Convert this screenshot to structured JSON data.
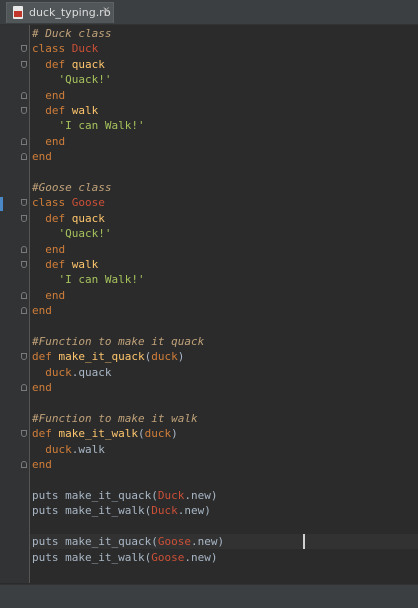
{
  "tab": {
    "filename": "duck_typing.rb",
    "file_icon": "ruby-file-icon",
    "close_glyph": "×"
  },
  "colors": {
    "editor_bg": "#2b2b2b",
    "comment": "#c0a27a",
    "keyword": "#d07d39",
    "constant": "#cc4f37",
    "method_name": "#ffc66d",
    "string": "#a5c25c",
    "plain": "#a9b7c6"
  },
  "code_lines": [
    [
      {
        "t": "comment",
        "s": "# Duck class"
      }
    ],
    [
      {
        "t": "keyword",
        "s": "class "
      },
      {
        "t": "const",
        "s": "Duck"
      }
    ],
    [
      {
        "t": "plain",
        "s": "  "
      },
      {
        "t": "keyword",
        "s": "def "
      },
      {
        "t": "method",
        "s": "quack"
      }
    ],
    [
      {
        "t": "plain",
        "s": "    "
      },
      {
        "t": "string",
        "s": "'Quack!'"
      }
    ],
    [
      {
        "t": "plain",
        "s": "  "
      },
      {
        "t": "keyword",
        "s": "end"
      }
    ],
    [
      {
        "t": "plain",
        "s": "  "
      },
      {
        "t": "keyword",
        "s": "def "
      },
      {
        "t": "method",
        "s": "walk"
      }
    ],
    [
      {
        "t": "plain",
        "s": "    "
      },
      {
        "t": "string",
        "s": "'I can Walk!'"
      }
    ],
    [
      {
        "t": "plain",
        "s": "  "
      },
      {
        "t": "keyword",
        "s": "end"
      }
    ],
    [
      {
        "t": "keyword",
        "s": "end"
      }
    ],
    [],
    [
      {
        "t": "comment",
        "s": "#Goose class"
      }
    ],
    [
      {
        "t": "keyword",
        "s": "class "
      },
      {
        "t": "const",
        "s": "Goose"
      }
    ],
    [
      {
        "t": "plain",
        "s": "  "
      },
      {
        "t": "keyword",
        "s": "def "
      },
      {
        "t": "method",
        "s": "quack"
      }
    ],
    [
      {
        "t": "plain",
        "s": "    "
      },
      {
        "t": "string",
        "s": "'Quack!'"
      }
    ],
    [
      {
        "t": "plain",
        "s": "  "
      },
      {
        "t": "keyword",
        "s": "end"
      }
    ],
    [
      {
        "t": "plain",
        "s": "  "
      },
      {
        "t": "keyword",
        "s": "def "
      },
      {
        "t": "method",
        "s": "walk"
      }
    ],
    [
      {
        "t": "plain",
        "s": "    "
      },
      {
        "t": "string",
        "s": "'I can Walk!'"
      }
    ],
    [
      {
        "t": "plain",
        "s": "  "
      },
      {
        "t": "keyword",
        "s": "end"
      }
    ],
    [
      {
        "t": "keyword",
        "s": "end"
      }
    ],
    [],
    [
      {
        "t": "comment",
        "s": "#Function to make it quack"
      }
    ],
    [
      {
        "t": "keyword",
        "s": "def "
      },
      {
        "t": "method",
        "s": "make_it_quack"
      },
      {
        "t": "plain",
        "s": "("
      },
      {
        "t": "keyword",
        "s": "duck"
      },
      {
        "t": "plain",
        "s": ")"
      }
    ],
    [
      {
        "t": "plain",
        "s": "  "
      },
      {
        "t": "keyword",
        "s": "duck"
      },
      {
        "t": "plain",
        "s": ".quack"
      }
    ],
    [
      {
        "t": "keyword",
        "s": "end"
      }
    ],
    [],
    [
      {
        "t": "comment",
        "s": "#Function to make it walk"
      }
    ],
    [
      {
        "t": "keyword",
        "s": "def "
      },
      {
        "t": "method",
        "s": "make_it_walk"
      },
      {
        "t": "plain",
        "s": "("
      },
      {
        "t": "keyword",
        "s": "duck"
      },
      {
        "t": "plain",
        "s": ")"
      }
    ],
    [
      {
        "t": "plain",
        "s": "  "
      },
      {
        "t": "keyword",
        "s": "duck"
      },
      {
        "t": "plain",
        "s": ".walk"
      }
    ],
    [
      {
        "t": "keyword",
        "s": "end"
      }
    ],
    [],
    [
      {
        "t": "plain",
        "s": "puts make_it_quack("
      },
      {
        "t": "const",
        "s": "Duck"
      },
      {
        "t": "plain",
        "s": ".new)"
      }
    ],
    [
      {
        "t": "plain",
        "s": "puts make_it_walk("
      },
      {
        "t": "const",
        "s": "Duck"
      },
      {
        "t": "plain",
        "s": ".new)"
      }
    ],
    [],
    [
      {
        "t": "plain",
        "s": "puts make_it_quack("
      },
      {
        "t": "const",
        "s": "Goose"
      },
      {
        "t": "plain",
        "s": ".new)"
      }
    ],
    [
      {
        "t": "plain",
        "s": "puts make_it_walk("
      },
      {
        "t": "const",
        "s": "Goose"
      },
      {
        "t": "plain",
        "s": ".new)"
      }
    ]
  ]
}
